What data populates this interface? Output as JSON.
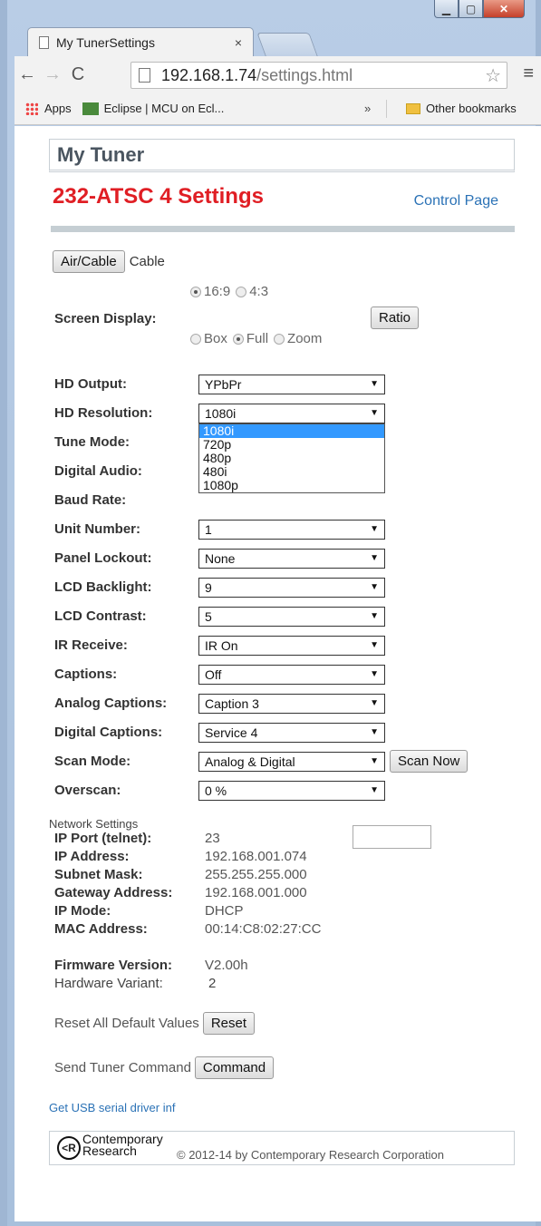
{
  "browser": {
    "tab_title": "My TunerSettings",
    "tab_close": "×",
    "url_host": "192.168.1.74",
    "url_path": "/settings.html",
    "bookmarks": [
      "Apps",
      "Eclipse | MCU on Ecl..."
    ],
    "bookmarks_overflow": "»",
    "other_bookmarks": "Other bookmarks"
  },
  "header": {
    "brand": "My Tuner",
    "page_title": "232-ATSC 4 Settings",
    "control_link": "Control Page"
  },
  "air": {
    "button": "Air/Cable",
    "value": "Cable"
  },
  "screen": {
    "label": "Screen Display:",
    "aspect_options": [
      "16:9",
      "4:3"
    ],
    "aspect_selected": "16:9",
    "mode_options": [
      "Box",
      "Full",
      "Zoom"
    ],
    "mode_selected": "Full",
    "ratio_button": "Ratio"
  },
  "settings": [
    {
      "label": "HD Output:",
      "value": "YPbPr"
    },
    {
      "label": "HD Resolution:",
      "value": "1080i"
    },
    {
      "label": "Tune Mode:",
      "value": ""
    },
    {
      "label": "Digital Audio:",
      "value": ""
    },
    {
      "label": "Baud Rate:",
      "value": ""
    },
    {
      "label": "Unit Number:",
      "value": "1"
    },
    {
      "label": "Panel Lockout:",
      "value": "None"
    },
    {
      "label": "LCD Backlight:",
      "value": "9"
    },
    {
      "label": "LCD Contrast:",
      "value": "5"
    },
    {
      "label": "IR Receive:",
      "value": "IR On"
    },
    {
      "label": "Captions:",
      "value": "Off"
    },
    {
      "label": "Analog Captions:",
      "value": "Caption 3"
    },
    {
      "label": "Digital Captions:",
      "value": "Service 4"
    },
    {
      "label": "Scan Mode:",
      "value": "Analog & Digital"
    },
    {
      "label": "Overscan:",
      "value": "0 %"
    }
  ],
  "scan_now": "Scan Now",
  "resolution_dropdown": [
    "1080i",
    "720p",
    "480p",
    "480i",
    "1080p"
  ],
  "network": {
    "heading": "Network Settings",
    "rows": [
      {
        "label": "IP Port (telnet):",
        "value": "23"
      },
      {
        "label": "IP Address:",
        "value": "192.168.001.074"
      },
      {
        "label": "Subnet Mask:",
        "value": "255.255.255.000"
      },
      {
        "label": "Gateway Address:",
        "value": "192.168.001.000"
      },
      {
        "label": "IP Mode:",
        "value": "DHCP"
      },
      {
        "label": "MAC Address:",
        "value": "00:14:C8:02:27:CC"
      }
    ]
  },
  "firmware": {
    "label": "Firmware Version:",
    "value": "V2.00h",
    "hw_label": "Hardware Variant:",
    "hw_value": "2"
  },
  "reset": {
    "label": "Reset All Default Values",
    "button": "Reset"
  },
  "command": {
    "label": "Send Tuner Command",
    "button": "Command"
  },
  "usb_link": "Get USB serial driver inf",
  "footer": {
    "logo_line1": "Contemporary",
    "logo_line2": "Research",
    "copyright": "© 2012-14 by Contemporary Research Corporation"
  }
}
